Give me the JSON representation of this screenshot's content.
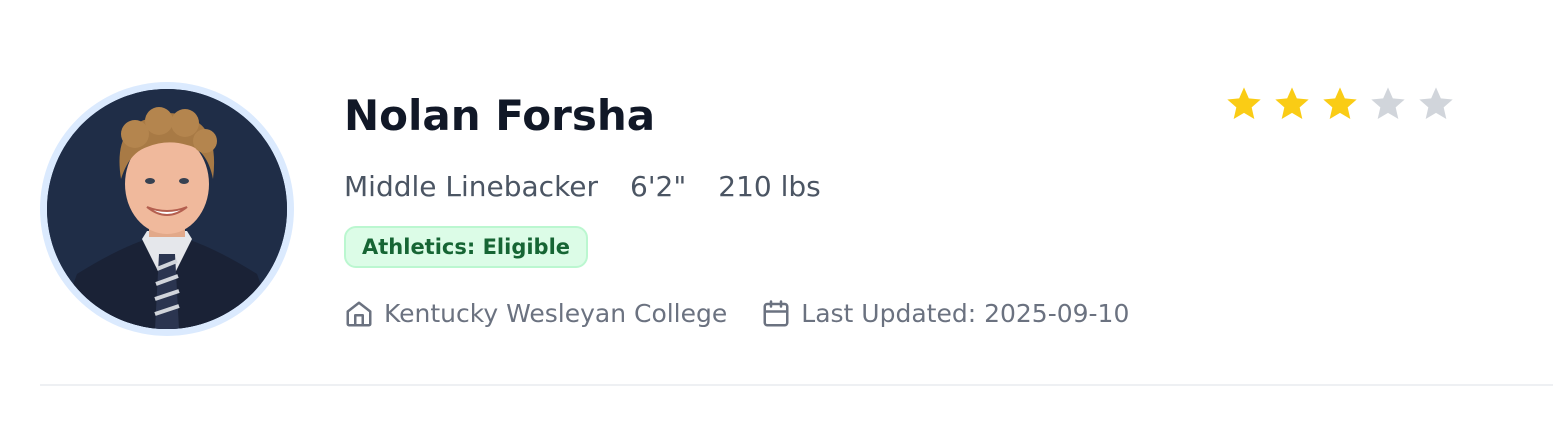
{
  "profile": {
    "name": "Nolan Forsha",
    "position": "Middle Linebacker",
    "height": "6'2\"",
    "weight": "210 lbs",
    "badge": "Athletics: Eligible",
    "school": "Kentucky Wesleyan College",
    "last_updated": "Last Updated: 2025-09-10",
    "avatar_icon": "player-headshot"
  },
  "rating": {
    "value": 3,
    "max": 5,
    "filled_color": "#facc15",
    "empty_color": "#d1d5db"
  },
  "colors": {
    "badge_bg": "#dcfce7",
    "badge_text": "#166534",
    "avatar_ring": "#dbeafe"
  }
}
